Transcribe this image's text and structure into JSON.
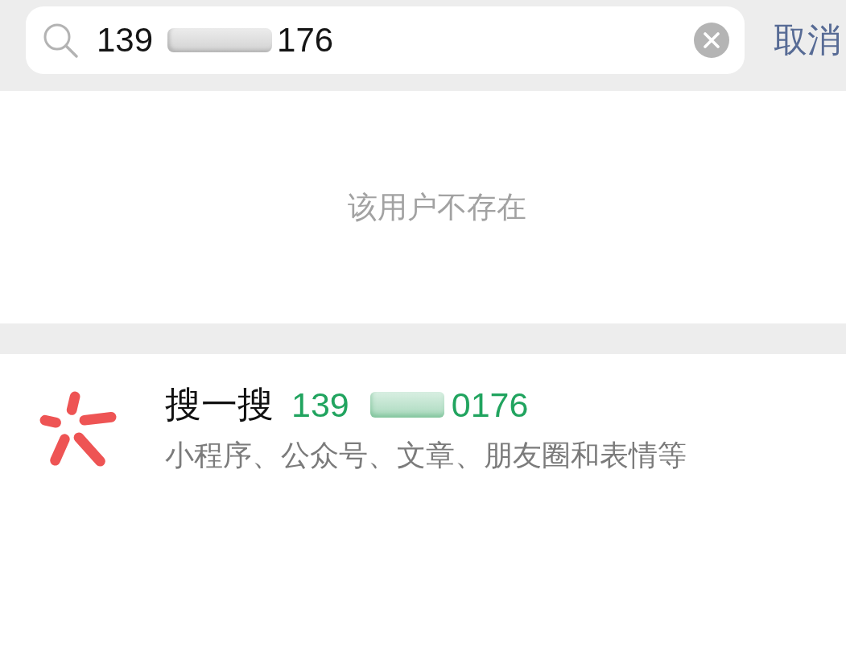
{
  "search": {
    "query": [
      {
        "kind": "text",
        "text": "139"
      },
      {
        "kind": "redacted"
      },
      {
        "kind": "text",
        "text": "176"
      }
    ],
    "cancel": "取消"
  },
  "notice": "该用户不存在",
  "result": {
    "title": "搜一搜",
    "query": [
      {
        "kind": "text",
        "text": "139"
      },
      {
        "kind": "redacted"
      },
      {
        "kind": "text",
        "text": "0176"
      }
    ],
    "subtitle": "小程序、公众号、文章、朋友圈和表情等"
  }
}
